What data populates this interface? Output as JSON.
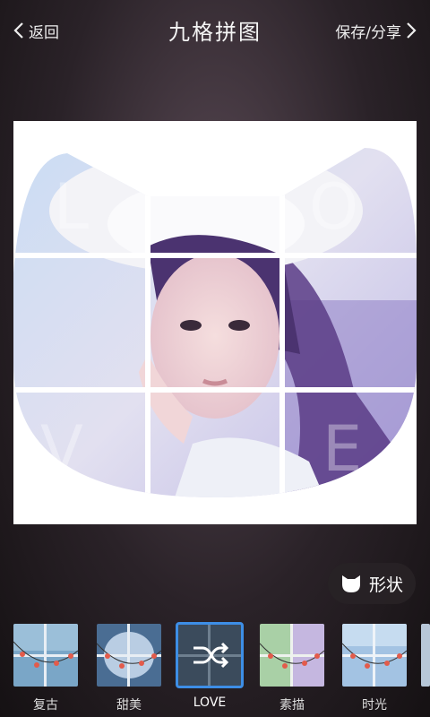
{
  "header": {
    "back_label": "返回",
    "title": "九格拼图",
    "save_label": "保存/分享"
  },
  "canvas": {
    "shape": "cat-head",
    "watermark_letters": [
      "L",
      "O",
      "V",
      "E"
    ],
    "grid": "3x3"
  },
  "shape_button": {
    "label": "形状",
    "icon": "cat-head-icon"
  },
  "filters": [
    {
      "label": "复古",
      "selected": false
    },
    {
      "label": "甜美",
      "selected": false
    },
    {
      "label": "LOVE",
      "selected": true,
      "icon": "shuffle-icon"
    },
    {
      "label": "素描",
      "selected": false
    },
    {
      "label": "时光",
      "selected": false
    }
  ],
  "colors": {
    "selected_border": "#3d8ee6"
  }
}
